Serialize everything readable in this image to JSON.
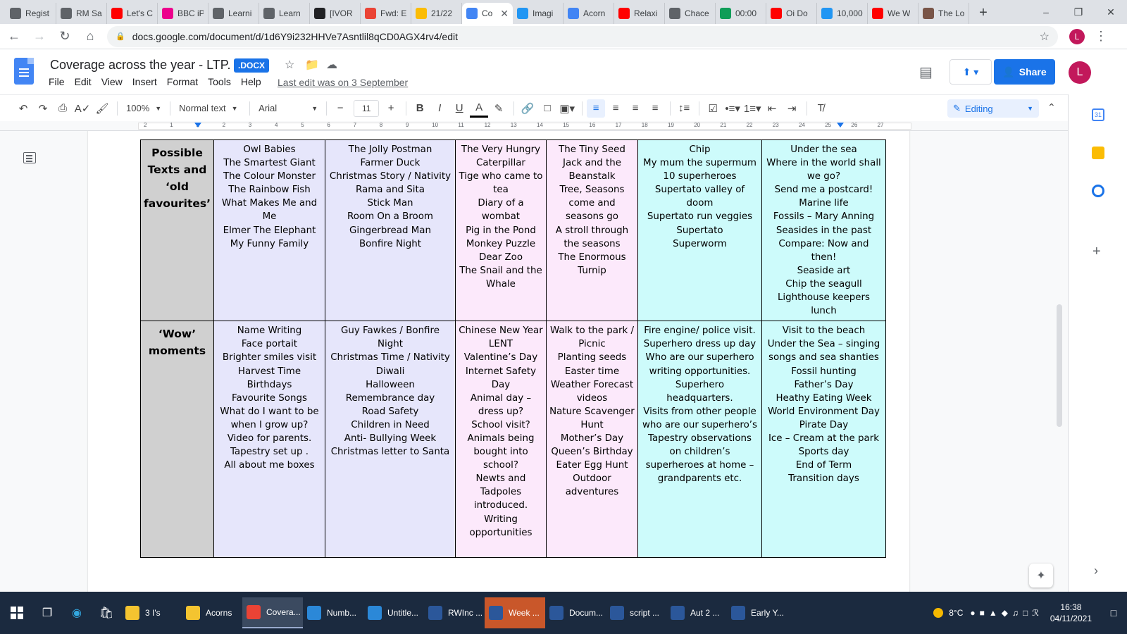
{
  "browser": {
    "tabs": [
      {
        "label": "Regist",
        "color": "#5f6368"
      },
      {
        "label": "RM Sa",
        "color": "#5f6368"
      },
      {
        "label": "Let's C",
        "color": "#ff0000"
      },
      {
        "label": "BBC iP",
        "color": "#ec008c"
      },
      {
        "label": "Learni",
        "color": "#5f6368"
      },
      {
        "label": "Learn",
        "color": "#5f6368"
      },
      {
        "label": "[IVOR",
        "color": "#202124"
      },
      {
        "label": "Fwd: E",
        "color": "#ea4335"
      },
      {
        "label": "21/22",
        "color": "#fbbc04"
      },
      {
        "label": "Co",
        "color": "#4285f4",
        "active": true
      },
      {
        "label": "Imagi",
        "color": "#2196f3"
      },
      {
        "label": "Acorn",
        "color": "#4285f4"
      },
      {
        "label": "Relaxi",
        "color": "#ff0000"
      },
      {
        "label": "Chace",
        "color": "#5f6368"
      },
      {
        "label": "00:00",
        "color": "#0f9d58"
      },
      {
        "label": "Oi Do",
        "color": "#ff0000"
      },
      {
        "label": "10,000",
        "color": "#2196f3"
      },
      {
        "label": "We W",
        "color": "#ff0000"
      },
      {
        "label": "The Lo",
        "color": "#795548"
      }
    ],
    "new_tab": "+",
    "url": "docs.google.com/document/d/1d6Y9i232HHVe7Asntlil8qCD0AGX4rv4/edit",
    "profile_initial": "L"
  },
  "docs": {
    "title": "Coverage across the year - LTP.",
    "badge": ".DOCX",
    "menu": [
      "File",
      "Edit",
      "View",
      "Insert",
      "Format",
      "Tools",
      "Help"
    ],
    "last_edit": "Last edit was on 3 September",
    "share_label": "Share",
    "user_initial": "L",
    "toolbar": {
      "zoom": "100%",
      "style": "Normal text",
      "font": "Arial",
      "font_size": "11",
      "mode": "Editing"
    },
    "accent_color": "#1a73e8"
  },
  "ruler_ticks": [
    "2",
    "1",
    "1",
    "2",
    "3",
    "4",
    "5",
    "6",
    "7",
    "8",
    "9",
    "10",
    "11",
    "12",
    "13",
    "14",
    "15",
    "16",
    "17",
    "18",
    "19",
    "20",
    "21",
    "22",
    "23",
    "24",
    "25",
    "26",
    "27"
  ],
  "table": {
    "rows": [
      {
        "header": "Possible Texts and ‘old favourites’",
        "cells": [
          "Owl Babies\nThe Smartest Giant\nThe Colour Monster\nThe Rainbow Fish\nWhat Makes Me and Me\nElmer The Elephant\nMy Funny Family",
          "The Jolly Postman\nFarmer Duck\nChristmas Story / Nativity\nRama and Sita\nStick Man\nRoom On a Broom\nGingerbread Man\nBonfire Night",
          "The Very Hungry Caterpillar\nTige who came to tea\nDiary of a wombat\nPig in the Pond\nMonkey Puzzle\nDear Zoo\nThe Snail and the Whale",
          "The Tiny Seed\nJack and the Beanstalk\nTree, Seasons come and seasons go\nA stroll through the seasons\nThe Enormous Turnip",
          "Chip\nMy mum the supermum\n10 superheroes\nSupertato valley of doom\nSupertato run veggies\nSupertato\nSuperworm",
          "Under the sea\nWhere in the world shall we go?\nSend me a postcard!\nMarine life\nFossils – Mary Anning\nSeasides in the past\nCompare: Now and then!\nSeaside art\nChip the seagull\nLighthouse keepers lunch"
        ]
      },
      {
        "header": "‘Wow’ moments",
        "cells": [
          "Name Writing\nFace portait\nBrighter smiles visit\nHarvest Time\nBirthdays\nFavourite Songs\nWhat do I want to be when I grow up?\nVideo for parents.\nTapestry set up .\nAll about me boxes",
          "Guy Fawkes / Bonfire Night\nChristmas Time  / Nativity\nDiwali\nHalloween\nRemembrance day\nRoad Safety\nChildren in Need\nAnti- Bullying Week\nChristmas letter to Santa",
          "Chinese New Year\nLENT\nValentine’s Day\nInternet Safety Day\nAnimal day – dress up?\nSchool visit?\nAnimals being bought into school?\nNewts and Tadpoles introduced.\nWriting opportunities",
          "Walk to the park / Picnic\nPlanting seeds\nEaster time\nWeather Forecast videos\nNature Scavenger Hunt\nMother’s Day\nQueen’s Birthday\nEater Egg Hunt\nOutdoor adventures",
          "Fire engine/ police visit.\nSuperhero dress up day\nWho are our superhero writing opportunities.\nSuperhero headquarters.\nVisits from other people who are our superhero’s\nTapestry observations on children’s superheroes at home – grandparents etc.",
          "Visit to the beach\nUnder the Sea – singing songs and sea shanties\nFossil hunting\nFather’s Day\nHeathy Eating Week\nWorld Environment Day\nPirate Day\nIce – Cream at the park\nSports day\nEnd of Term\nTransition days"
        ]
      }
    ],
    "column_colors": [
      "#e6e6fb",
      "#e6e6fb",
      "#fce9fb",
      "#fce9fb",
      "#cdfbfb",
      "#cdfbfb"
    ]
  },
  "taskbar": {
    "tasks": [
      {
        "label": "3 I's",
        "color": "#f4c430"
      },
      {
        "label": "Acorns",
        "color": "#f4c430"
      },
      {
        "label": "Covera...",
        "color": "#ea4335",
        "active": true
      },
      {
        "label": "Numb...",
        "color": "#2b88d8"
      },
      {
        "label": "Untitle...",
        "color": "#2b88d8"
      },
      {
        "label": "RWInc ...",
        "color": "#2b579a"
      },
      {
        "label": "Week ...",
        "color": "#2b579a",
        "highlight": true
      },
      {
        "label": "Docum...",
        "color": "#2b579a"
      },
      {
        "label": "script ...",
        "color": "#2b579a"
      },
      {
        "label": "Aut 2 ...",
        "color": "#2b579a"
      },
      {
        "label": "Early Y...",
        "color": "#2b579a"
      }
    ],
    "temperature": "8°C",
    "time": "16:38",
    "date": "04/11/2021"
  }
}
